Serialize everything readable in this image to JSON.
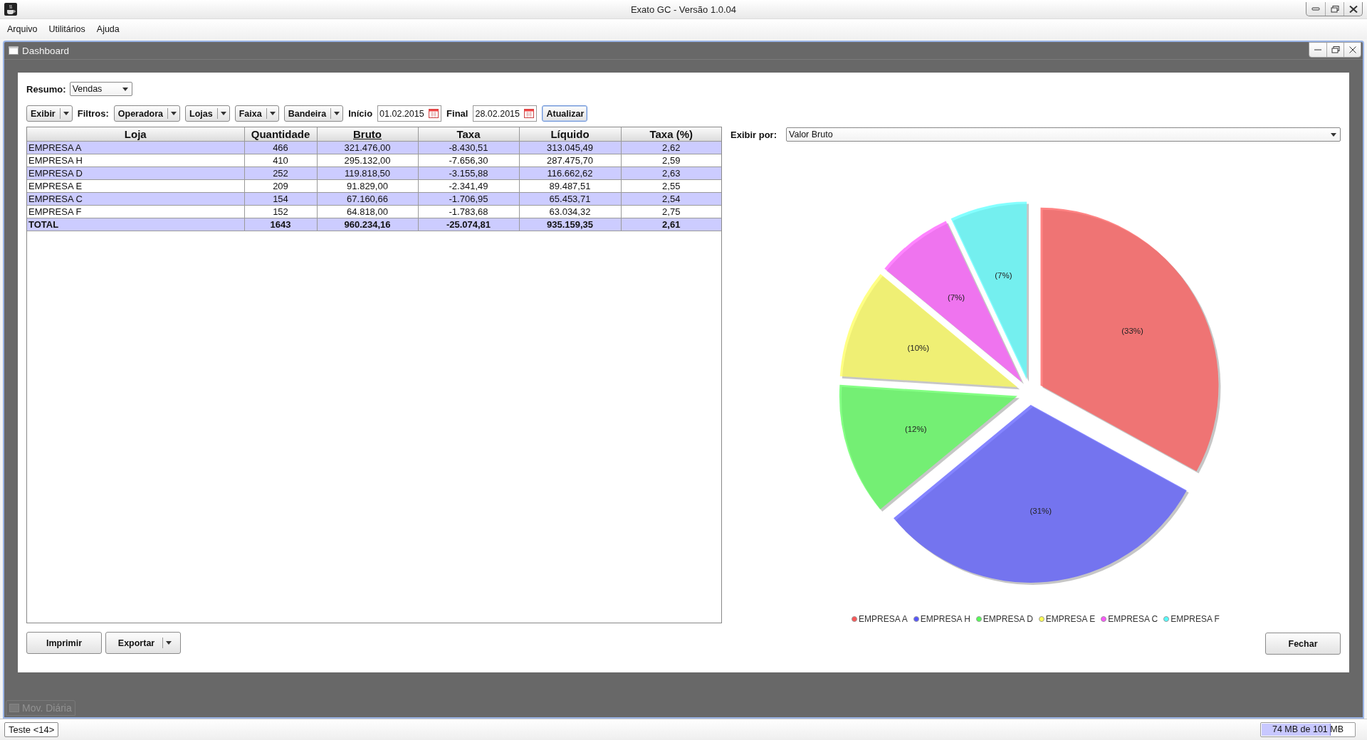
{
  "window": {
    "title": "Exato GC - Versão 1.0.04"
  },
  "menu": [
    "Arquivo",
    "Utilitários",
    "Ajuda"
  ],
  "frame": {
    "title": "Dashboard"
  },
  "resumo": {
    "label": "Resumo:",
    "value": "Vendas"
  },
  "filters": {
    "exibir": "Exibir",
    "label": "Filtros:",
    "dropdowns": [
      "Operadora",
      "Lojas",
      "Faixa",
      "Bandeira"
    ],
    "inicio": {
      "label": "Início",
      "value": "01.02.2015"
    },
    "final": {
      "label": "Final",
      "value": "28.02.2015"
    },
    "refresh": "Atualizar"
  },
  "table": {
    "columns": [
      {
        "label": "Loja",
        "sorted": false
      },
      {
        "label": "Quantidade",
        "sorted": false
      },
      {
        "label": "Bruto",
        "sorted": true
      },
      {
        "label": "Taxa",
        "sorted": false
      },
      {
        "label": "Líquido",
        "sorted": false
      },
      {
        "label": "Taxa (%)",
        "sorted": false
      }
    ],
    "rows": [
      {
        "kind": "data",
        "cells": [
          "EMPRESA A",
          "466",
          "321.476,00",
          "-8.430,51",
          "313.045,49",
          "2,62"
        ]
      },
      {
        "kind": "data",
        "cells": [
          "EMPRESA H",
          "410",
          "295.132,00",
          "-7.656,30",
          "287.475,70",
          "2,59"
        ]
      },
      {
        "kind": "data",
        "cells": [
          "EMPRESA D",
          "252",
          "119.818,50",
          "-3.155,88",
          "116.662,62",
          "2,63"
        ]
      },
      {
        "kind": "data",
        "cells": [
          "EMPRESA E",
          "209",
          "91.829,00",
          "-2.341,49",
          "89.487,51",
          "2,55"
        ]
      },
      {
        "kind": "data",
        "cells": [
          "EMPRESA C",
          "154",
          "67.160,66",
          "-1.706,95",
          "65.453,71",
          "2,54"
        ]
      },
      {
        "kind": "data",
        "cells": [
          "EMPRESA F",
          "152",
          "64.818,00",
          "-1.783,68",
          "63.034,32",
          "2,75"
        ]
      },
      {
        "kind": "total",
        "cells": [
          "TOTAL",
          "1643",
          "960.234,16",
          "-25.074,81",
          "935.159,35",
          "2,61"
        ]
      }
    ]
  },
  "exibir_por": {
    "label": "Exibir por:",
    "value": "Valor Bruto"
  },
  "chart_data": {
    "type": "pie",
    "categories": [
      "EMPRESA A",
      "EMPRESA H",
      "EMPRESA D",
      "EMPRESA E",
      "EMPRESA C",
      "EMPRESA F"
    ],
    "values": [
      33,
      31,
      12,
      10,
      7,
      7
    ],
    "value_labels": [
      "(33%)",
      "(31%)",
      "(12%)",
      "(10%)",
      "(7%)",
      "(7%)"
    ]
  },
  "legend": [
    {
      "color": "#ff5555"
    },
    {
      "color": "#5555ff"
    },
    {
      "color": "#55ff55"
    },
    {
      "color": "#ffff55"
    },
    {
      "color": "#ff55ff"
    },
    {
      "color": "#55ffff"
    }
  ],
  "buttons": {
    "print": "Imprimir",
    "export": "Exportar",
    "close": "Fechar"
  },
  "minimized": {
    "title": "Mov. Diária"
  },
  "status": {
    "session": "Teste <14>",
    "memory": "74 MB de 101 MB",
    "level": 0.73
  }
}
